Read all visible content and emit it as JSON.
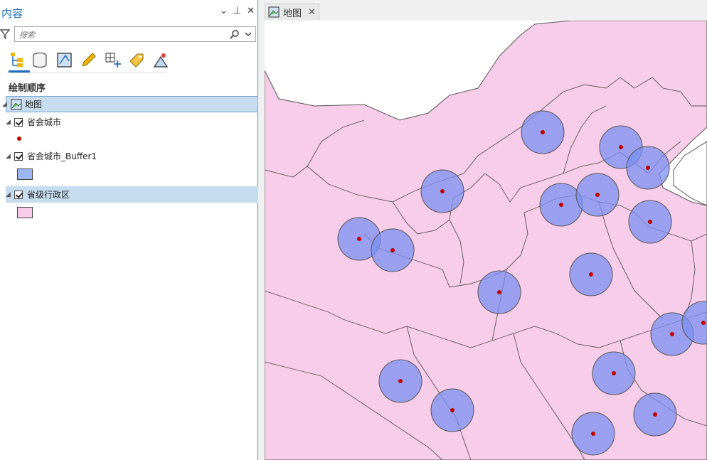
{
  "contents_pane": {
    "title": "内容",
    "search_placeholder": "搜索",
    "section_title": "绘制顺序",
    "map_item": "地图",
    "layers": [
      {
        "name": "省会城市",
        "symbol": "point",
        "color": "#c00000"
      },
      {
        "name": "省会城市_Buffer1",
        "symbol": "polygon",
        "color": "#9db7f5"
      },
      {
        "name": "省级行政区",
        "symbol": "polygon",
        "color": "#f8cde9"
      }
    ]
  },
  "toolbar_icons": [
    "drawing-order-icon",
    "data-source-icon",
    "selection-icon",
    "editing-icon",
    "snapping-icon",
    "labeling-icon",
    "chart-icon"
  ],
  "map_tab": {
    "label": "地图"
  },
  "colors": {
    "province_fill": "#f8cde9",
    "province_stroke": "#555555",
    "buffer_fill": "#7b8ff0",
    "buffer_stroke": "#555555",
    "city_point": "#c00000",
    "accent": "#1c6fbe"
  }
}
